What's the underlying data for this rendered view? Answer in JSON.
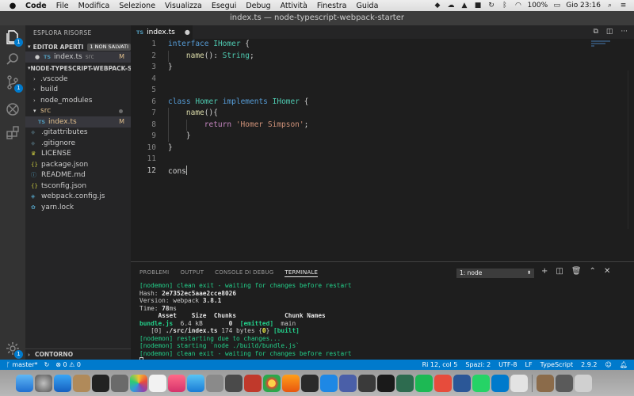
{
  "menubar": {
    "app": "Code",
    "items": [
      "File",
      "Modifica",
      "Selezione",
      "Visualizza",
      "Esegui",
      "Debug",
      "Attività",
      "Finestra",
      "Guida"
    ],
    "battery": "100%",
    "clock": "Gio 23:16"
  },
  "window": {
    "title": "index.ts — node-typescript-webpack-starter"
  },
  "activity": {
    "explorer_badge": "1",
    "scm_badge": "1"
  },
  "sidebar": {
    "title": "ESPLORA RISORSE",
    "open_editors": {
      "label": "EDITOR APERTI",
      "badge": "1 NON SALVATI",
      "file": "index.ts",
      "folder": "src",
      "status": "M"
    },
    "project": {
      "label": "NODE-TYPESCRIPT-WEBPACK-S..."
    },
    "tree": [
      {
        "name": ".vscode",
        "kind": "folder"
      },
      {
        "name": "build",
        "kind": "folder"
      },
      {
        "name": "node_modules",
        "kind": "folder"
      },
      {
        "name": "src",
        "kind": "folder-open"
      },
      {
        "name": "index.ts",
        "kind": "ts",
        "status": "M"
      },
      {
        "name": ".gitattributes",
        "kind": "git"
      },
      {
        "name": ".gitignore",
        "kind": "git"
      },
      {
        "name": "LICENSE",
        "kind": "lic"
      },
      {
        "name": "package.json",
        "kind": "json"
      },
      {
        "name": "README.md",
        "kind": "md"
      },
      {
        "name": "tsconfig.json",
        "kind": "json"
      },
      {
        "name": "webpack.config.js",
        "kind": "js"
      },
      {
        "name": "yarn.lock",
        "kind": "yarn"
      }
    ],
    "outline": "CONTORNO"
  },
  "editor": {
    "tab": {
      "label": "index.ts",
      "dirty": "●"
    },
    "lines": [
      "1",
      "2",
      "3",
      "4",
      "5",
      "6",
      "7",
      "8",
      "9",
      "10",
      "11",
      "12"
    ]
  },
  "panel": {
    "tabs": [
      "PROBLEMI",
      "OUTPUT",
      "CONSOLE DI DEBUG",
      "TERMINALE"
    ],
    "active_tab": "TERMINALE",
    "terminal_select": "1: node"
  },
  "statusbar": {
    "branch": "master*",
    "errors": "0",
    "warnings": "0",
    "position": "Ri 12, col 5",
    "spaces": "Spazi: 2",
    "encoding": "UTF-8",
    "eol": "LF",
    "language": "TypeScript",
    "version": "2.9.2"
  },
  "colors": {
    "accent": "#007acc",
    "keyword": "#569cd6",
    "type": "#4ec9b0",
    "string": "#ce9178",
    "terminal_green": "#23d18b"
  }
}
